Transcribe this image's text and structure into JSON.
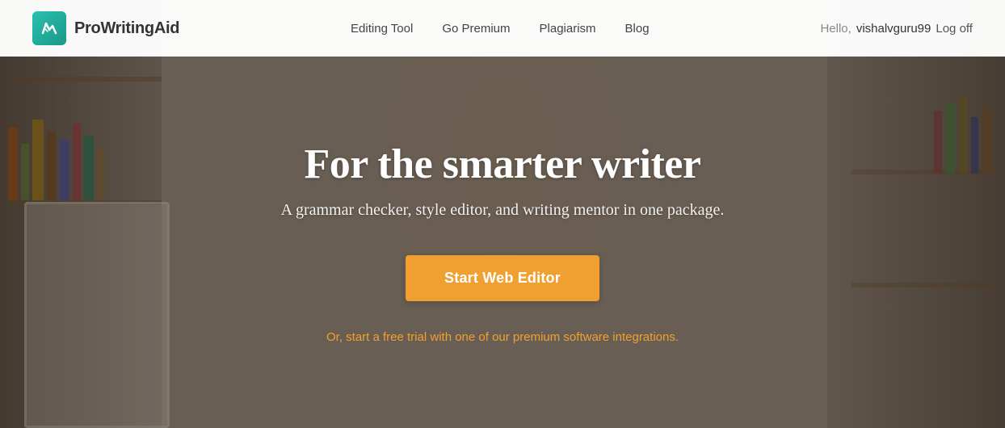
{
  "brand": {
    "name": "ProWritingAid",
    "logo_alt": "ProWritingAid logo"
  },
  "nav": {
    "links": [
      {
        "label": "Editing Tool",
        "id": "editing-tool"
      },
      {
        "label": "Go Premium",
        "id": "go-premium"
      },
      {
        "label": "Plagiarism",
        "id": "plagiarism"
      },
      {
        "label": "Blog",
        "id": "blog"
      }
    ],
    "hello_label": "Hello,",
    "username": "vishalvguru99",
    "logoff_label": "Log off"
  },
  "hero": {
    "title": "For the smarter writer",
    "subtitle": "A grammar checker, style editor, and writing mentor in one package.",
    "cta_label": "Start Web Editor",
    "secondary_text": "Or, start a free trial with one of our premium software integrations."
  },
  "colors": {
    "teal": "#2abfb0",
    "orange": "#f0a030",
    "white": "#ffffff"
  }
}
